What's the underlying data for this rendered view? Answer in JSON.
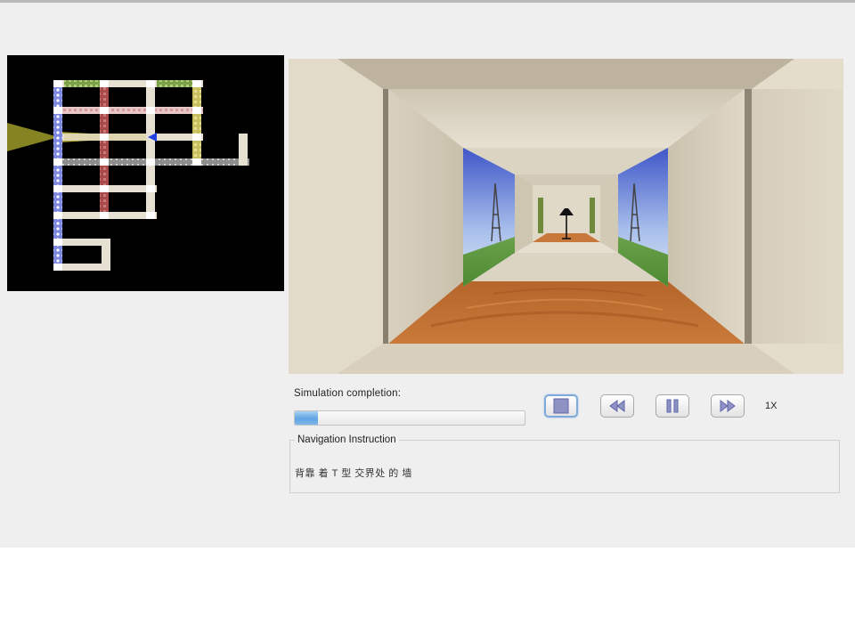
{
  "simulation": {
    "completion_label": "Simulation completion:",
    "progress_fraction": 0.1,
    "speed": "1X"
  },
  "controls": {
    "stop_icon": "stop-icon",
    "rewind_icon": "rewind-icon",
    "pause_icon": "pause-icon",
    "fast_forward_icon": "fast-forward-icon"
  },
  "navigation": {
    "title": "Navigation Instruction",
    "instruction": "背靠 着 T 型 交界处 的 墙"
  },
  "colors": {
    "accent": "#5fa4e2",
    "floor": "#c46a2a",
    "marker": "#2040e0"
  }
}
